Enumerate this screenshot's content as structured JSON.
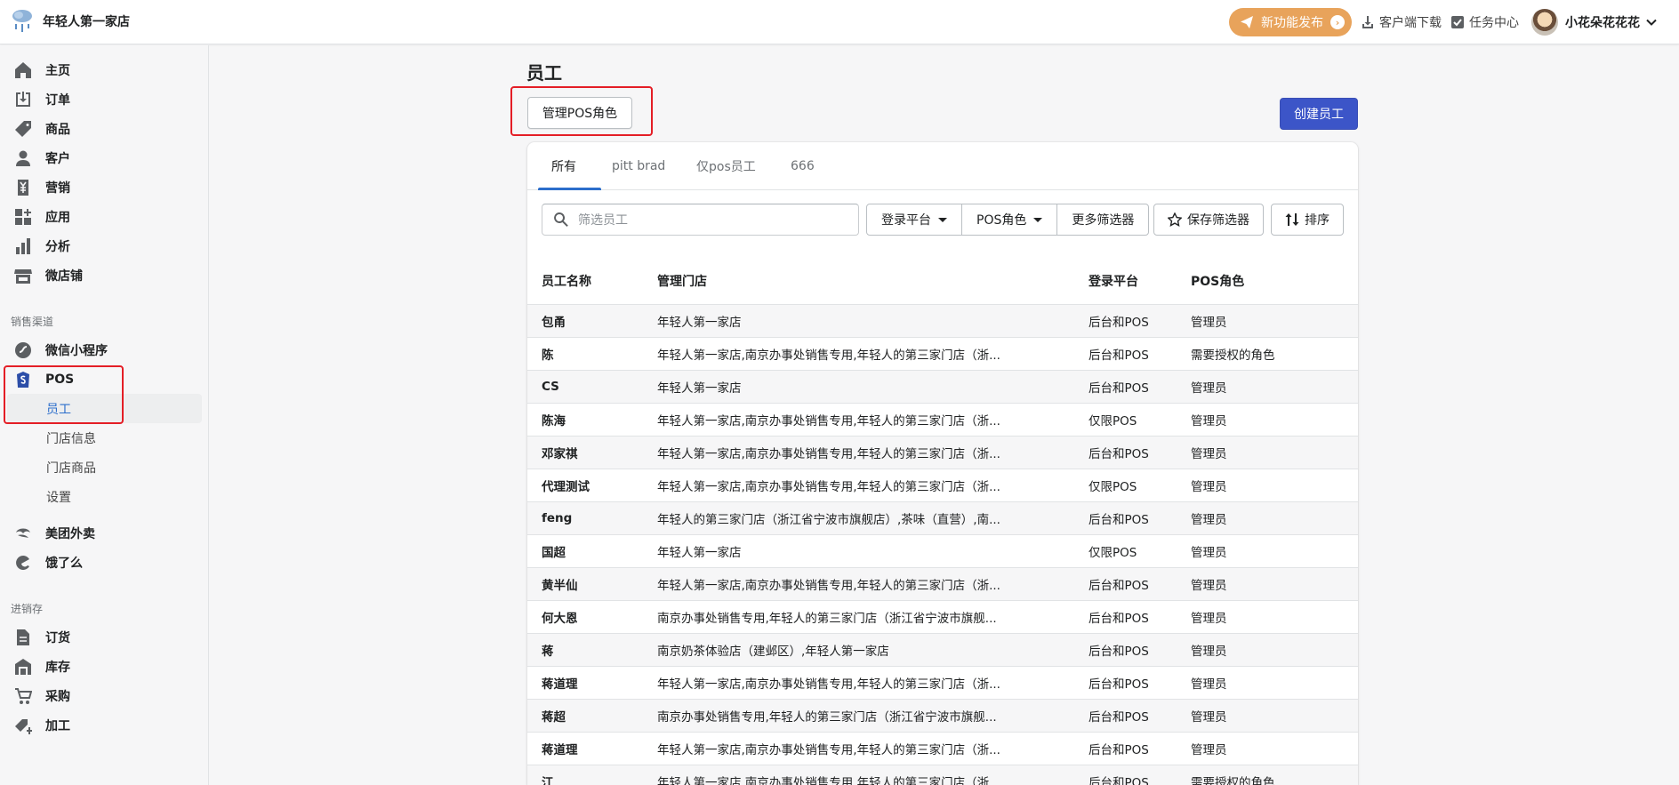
{
  "app": {
    "store_name": "年轻人第一家店"
  },
  "topbar": {
    "new_feature": "新功能发布",
    "client_download": "客户端下载",
    "task_center": "任务中心",
    "user_name": "小花朵花花花"
  },
  "sidebar": {
    "main_items": [
      {
        "label": "主页",
        "icon": "home-icon"
      },
      {
        "label": "订单",
        "icon": "orders-icon"
      },
      {
        "label": "商品",
        "icon": "tag-icon"
      },
      {
        "label": "客户",
        "icon": "person-icon"
      },
      {
        "label": "营销",
        "icon": "yuan-icon"
      },
      {
        "label": "应用",
        "icon": "apps-icon"
      },
      {
        "label": "分析",
        "icon": "analytics-icon"
      },
      {
        "label": "微店铺",
        "icon": "store-icon"
      }
    ],
    "sales_channel_title": "销售渠道",
    "channel_items": [
      {
        "label": "微信小程序",
        "icon": "link-icon"
      },
      {
        "label": "POS",
        "icon": "pos-icon"
      }
    ],
    "pos_sub_items": [
      "员工",
      "门店信息",
      "门店商品",
      "设置"
    ],
    "extra_channel_items": [
      {
        "label": "美团外卖",
        "icon": "meituan-icon"
      },
      {
        "label": "饿了么",
        "icon": "eleme-icon"
      }
    ],
    "inventory_title": "进销存",
    "inventory_items": [
      {
        "label": "订货",
        "icon": "document-icon"
      },
      {
        "label": "库存",
        "icon": "warehouse-icon"
      },
      {
        "label": "采购",
        "icon": "cart-icon"
      },
      {
        "label": "加工",
        "icon": "tag-plus-icon"
      }
    ]
  },
  "page": {
    "title": "员工",
    "manage_roles_button": "管理POS角色",
    "create_button": "创建员工"
  },
  "tabs": [
    "所有",
    "pitt brad",
    "仅pos员工",
    "666"
  ],
  "filters": {
    "search_placeholder": "筛选员工",
    "login_platform": "登录平台",
    "pos_role": "POS角色",
    "more_filters": "更多筛选器",
    "save_filter": "保存筛选器",
    "sort": "排序"
  },
  "table": {
    "headers": [
      "员工名称",
      "管理门店",
      "登录平台",
      "POS角色"
    ],
    "rows": [
      [
        "包甬",
        "年轻人第一家店",
        "后台和POS",
        "管理员"
      ],
      [
        "陈",
        "年轻人第一家店,南京办事处销售专用,年轻人的第三家门店（浙...",
        "后台和POS",
        "需要授权的角色"
      ],
      [
        "CS",
        "年轻人第一家店",
        "后台和POS",
        "管理员"
      ],
      [
        "陈海",
        "年轻人第一家店,南京办事处销售专用,年轻人的第三家门店（浙...",
        "仅限POS",
        "管理员"
      ],
      [
        "邓家祺",
        "年轻人第一家店,南京办事处销售专用,年轻人的第三家门店（浙...",
        "后台和POS",
        "管理员"
      ],
      [
        "代理测试",
        "年轻人第一家店,南京办事处销售专用,年轻人的第三家门店（浙...",
        "仅限POS",
        "管理员"
      ],
      [
        "feng",
        "年轻人的第三家门店（浙江省宁波市旗舰店）,茶味（直营）,南...",
        "后台和POS",
        "管理员"
      ],
      [
        "国超",
        "年轻人第一家店",
        "仅限POS",
        "管理员"
      ],
      [
        "黄半仙",
        "年轻人第一家店,南京办事处销售专用,年轻人的第三家门店（浙...",
        "后台和POS",
        "管理员"
      ],
      [
        "何大恩",
        "南京办事处销售专用,年轻人的第三家门店（浙江省宁波市旗舰...",
        "后台和POS",
        "管理员"
      ],
      [
        "蒋",
        "南京奶茶体验店（建邺区）,年轻人第一家店",
        "后台和POS",
        "管理员"
      ],
      [
        "蒋道理",
        "年轻人第一家店,南京办事处销售专用,年轻人的第三家门店（浙...",
        "后台和POS",
        "管理员"
      ],
      [
        "蒋超",
        "南京办事处销售专用,年轻人的第三家门店（浙江省宁波市旗舰...",
        "后台和POS",
        "管理员"
      ],
      [
        "蒋道理",
        "年轻人第一家店,南京办事处销售专用,年轻人的第三家门店（浙...",
        "后台和POS",
        "管理员"
      ],
      [
        "江",
        "年轻人第一家店,南京办事处销售专用,年轻人的第三家门店（浙...",
        "后台和POS",
        "需要授权的角色"
      ]
    ]
  },
  "colors": {
    "primary": "#3c55c8",
    "highlight": "#e41e26",
    "accent": "#e8a35b",
    "link": "#2c6ecb"
  }
}
